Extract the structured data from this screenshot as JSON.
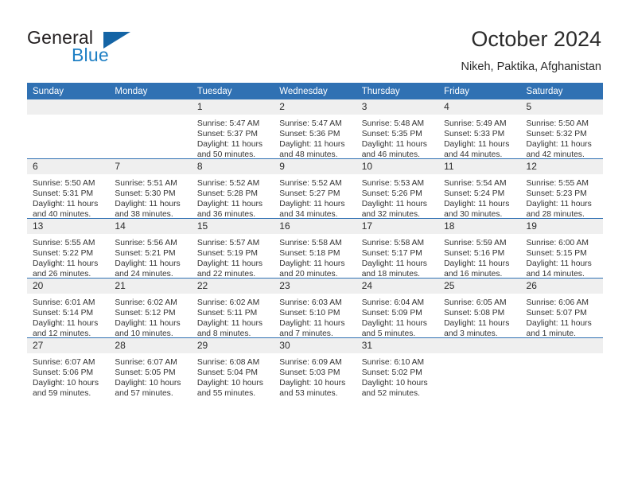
{
  "brand": {
    "name_top": "General",
    "name_bottom": "Blue",
    "triangle_color": "#1464a5",
    "blue_text_color": "#1e7fc4"
  },
  "header": {
    "title": "October 2024",
    "location": "Nikeh, Paktika, Afghanistan"
  },
  "theme": {
    "header_blue": "#3071b3",
    "daynum_gray": "#efefef",
    "text": "#333333"
  },
  "weekday_headers": [
    "Sunday",
    "Monday",
    "Tuesday",
    "Wednesday",
    "Thursday",
    "Friday",
    "Saturday"
  ],
  "labels": {
    "sunrise_prefix": "Sunrise:",
    "sunset_prefix": "Sunset:",
    "daylight_prefix": "Daylight:"
  },
  "weeks": [
    [
      {
        "day": "",
        "sunrise": "",
        "sunset": "",
        "daylight_1": "",
        "daylight_2": ""
      },
      {
        "day": "",
        "sunrise": "",
        "sunset": "",
        "daylight_1": "",
        "daylight_2": ""
      },
      {
        "day": "1",
        "sunrise": "Sunrise: 5:47 AM",
        "sunset": "Sunset: 5:37 PM",
        "daylight_1": "Daylight: 11 hours",
        "daylight_2": "and 50 minutes."
      },
      {
        "day": "2",
        "sunrise": "Sunrise: 5:47 AM",
        "sunset": "Sunset: 5:36 PM",
        "daylight_1": "Daylight: 11 hours",
        "daylight_2": "and 48 minutes."
      },
      {
        "day": "3",
        "sunrise": "Sunrise: 5:48 AM",
        "sunset": "Sunset: 5:35 PM",
        "daylight_1": "Daylight: 11 hours",
        "daylight_2": "and 46 minutes."
      },
      {
        "day": "4",
        "sunrise": "Sunrise: 5:49 AM",
        "sunset": "Sunset: 5:33 PM",
        "daylight_1": "Daylight: 11 hours",
        "daylight_2": "and 44 minutes."
      },
      {
        "day": "5",
        "sunrise": "Sunrise: 5:50 AM",
        "sunset": "Sunset: 5:32 PM",
        "daylight_1": "Daylight: 11 hours",
        "daylight_2": "and 42 minutes."
      }
    ],
    [
      {
        "day": "6",
        "sunrise": "Sunrise: 5:50 AM",
        "sunset": "Sunset: 5:31 PM",
        "daylight_1": "Daylight: 11 hours",
        "daylight_2": "and 40 minutes."
      },
      {
        "day": "7",
        "sunrise": "Sunrise: 5:51 AM",
        "sunset": "Sunset: 5:30 PM",
        "daylight_1": "Daylight: 11 hours",
        "daylight_2": "and 38 minutes."
      },
      {
        "day": "8",
        "sunrise": "Sunrise: 5:52 AM",
        "sunset": "Sunset: 5:28 PM",
        "daylight_1": "Daylight: 11 hours",
        "daylight_2": "and 36 minutes."
      },
      {
        "day": "9",
        "sunrise": "Sunrise: 5:52 AM",
        "sunset": "Sunset: 5:27 PM",
        "daylight_1": "Daylight: 11 hours",
        "daylight_2": "and 34 minutes."
      },
      {
        "day": "10",
        "sunrise": "Sunrise: 5:53 AM",
        "sunset": "Sunset: 5:26 PM",
        "daylight_1": "Daylight: 11 hours",
        "daylight_2": "and 32 minutes."
      },
      {
        "day": "11",
        "sunrise": "Sunrise: 5:54 AM",
        "sunset": "Sunset: 5:24 PM",
        "daylight_1": "Daylight: 11 hours",
        "daylight_2": "and 30 minutes."
      },
      {
        "day": "12",
        "sunrise": "Sunrise: 5:55 AM",
        "sunset": "Sunset: 5:23 PM",
        "daylight_1": "Daylight: 11 hours",
        "daylight_2": "and 28 minutes."
      }
    ],
    [
      {
        "day": "13",
        "sunrise": "Sunrise: 5:55 AM",
        "sunset": "Sunset: 5:22 PM",
        "daylight_1": "Daylight: 11 hours",
        "daylight_2": "and 26 minutes."
      },
      {
        "day": "14",
        "sunrise": "Sunrise: 5:56 AM",
        "sunset": "Sunset: 5:21 PM",
        "daylight_1": "Daylight: 11 hours",
        "daylight_2": "and 24 minutes."
      },
      {
        "day": "15",
        "sunrise": "Sunrise: 5:57 AM",
        "sunset": "Sunset: 5:19 PM",
        "daylight_1": "Daylight: 11 hours",
        "daylight_2": "and 22 minutes."
      },
      {
        "day": "16",
        "sunrise": "Sunrise: 5:58 AM",
        "sunset": "Sunset: 5:18 PM",
        "daylight_1": "Daylight: 11 hours",
        "daylight_2": "and 20 minutes."
      },
      {
        "day": "17",
        "sunrise": "Sunrise: 5:58 AM",
        "sunset": "Sunset: 5:17 PM",
        "daylight_1": "Daylight: 11 hours",
        "daylight_2": "and 18 minutes."
      },
      {
        "day": "18",
        "sunrise": "Sunrise: 5:59 AM",
        "sunset": "Sunset: 5:16 PM",
        "daylight_1": "Daylight: 11 hours",
        "daylight_2": "and 16 minutes."
      },
      {
        "day": "19",
        "sunrise": "Sunrise: 6:00 AM",
        "sunset": "Sunset: 5:15 PM",
        "daylight_1": "Daylight: 11 hours",
        "daylight_2": "and 14 minutes."
      }
    ],
    [
      {
        "day": "20",
        "sunrise": "Sunrise: 6:01 AM",
        "sunset": "Sunset: 5:14 PM",
        "daylight_1": "Daylight: 11 hours",
        "daylight_2": "and 12 minutes."
      },
      {
        "day": "21",
        "sunrise": "Sunrise: 6:02 AM",
        "sunset": "Sunset: 5:12 PM",
        "daylight_1": "Daylight: 11 hours",
        "daylight_2": "and 10 minutes."
      },
      {
        "day": "22",
        "sunrise": "Sunrise: 6:02 AM",
        "sunset": "Sunset: 5:11 PM",
        "daylight_1": "Daylight: 11 hours",
        "daylight_2": "and 8 minutes."
      },
      {
        "day": "23",
        "sunrise": "Sunrise: 6:03 AM",
        "sunset": "Sunset: 5:10 PM",
        "daylight_1": "Daylight: 11 hours",
        "daylight_2": "and 7 minutes."
      },
      {
        "day": "24",
        "sunrise": "Sunrise: 6:04 AM",
        "sunset": "Sunset: 5:09 PM",
        "daylight_1": "Daylight: 11 hours",
        "daylight_2": "and 5 minutes."
      },
      {
        "day": "25",
        "sunrise": "Sunrise: 6:05 AM",
        "sunset": "Sunset: 5:08 PM",
        "daylight_1": "Daylight: 11 hours",
        "daylight_2": "and 3 minutes."
      },
      {
        "day": "26",
        "sunrise": "Sunrise: 6:06 AM",
        "sunset": "Sunset: 5:07 PM",
        "daylight_1": "Daylight: 11 hours",
        "daylight_2": "and 1 minute."
      }
    ],
    [
      {
        "day": "27",
        "sunrise": "Sunrise: 6:07 AM",
        "sunset": "Sunset: 5:06 PM",
        "daylight_1": "Daylight: 10 hours",
        "daylight_2": "and 59 minutes."
      },
      {
        "day": "28",
        "sunrise": "Sunrise: 6:07 AM",
        "sunset": "Sunset: 5:05 PM",
        "daylight_1": "Daylight: 10 hours",
        "daylight_2": "and 57 minutes."
      },
      {
        "day": "29",
        "sunrise": "Sunrise: 6:08 AM",
        "sunset": "Sunset: 5:04 PM",
        "daylight_1": "Daylight: 10 hours",
        "daylight_2": "and 55 minutes."
      },
      {
        "day": "30",
        "sunrise": "Sunrise: 6:09 AM",
        "sunset": "Sunset: 5:03 PM",
        "daylight_1": "Daylight: 10 hours",
        "daylight_2": "and 53 minutes."
      },
      {
        "day": "31",
        "sunrise": "Sunrise: 6:10 AM",
        "sunset": "Sunset: 5:02 PM",
        "daylight_1": "Daylight: 10 hours",
        "daylight_2": "and 52 minutes."
      },
      {
        "day": "",
        "sunrise": "",
        "sunset": "",
        "daylight_1": "",
        "daylight_2": ""
      },
      {
        "day": "",
        "sunrise": "",
        "sunset": "",
        "daylight_1": "",
        "daylight_2": ""
      }
    ]
  ]
}
